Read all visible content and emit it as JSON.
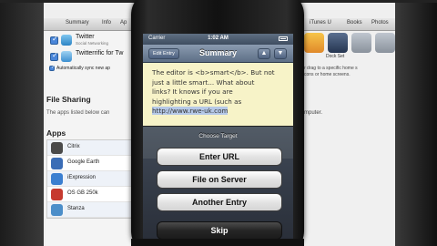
{
  "itunes": {
    "tabs": [
      "Summary",
      "Info",
      "Ap",
      "iTunes U",
      "Books",
      "Photos"
    ],
    "top_apps": [
      {
        "name": "Twitter",
        "sub": "Social Networking"
      },
      {
        "name": "Twitterrific for Tw",
        "sub": ""
      }
    ],
    "sync_label": "Automatically sync new ap",
    "file_sharing_title": "File Sharing",
    "file_sharing_desc": "The apps listed below can",
    "apps_title": "Apps",
    "apps": [
      {
        "name": "Citrix",
        "color": "#4a4a4a"
      },
      {
        "name": "Google Earth",
        "color": "#3a6db6"
      },
      {
        "name": "iExpression",
        "color": "#3b7fd0"
      },
      {
        "name": "OS GB 250k",
        "color": "#c63a2f"
      },
      {
        "name": "Stanza",
        "color": "#4c8ec9"
      }
    ],
    "right_text_1": "r drag to a specific home s",
    "right_text_2": "cons or home screens.",
    "right_text_3": "mputer.",
    "dock_set_label": "Dock Set"
  },
  "phone": {
    "carrier": "Carrier",
    "time": "1:02 AM",
    "nav_back": "Edit Entry",
    "nav_title": "Summary",
    "nav_up": "▲",
    "nav_down": "▼",
    "note_lines": [
      "The editor is <b>smart</b>. But not",
      "just a little smart... What about",
      "links? It knows if you are",
      "highlighting a URL (such as"
    ],
    "note_url": "http://www.rwe-uk.com"
  },
  "action_sheet": {
    "title": "Choose Target",
    "buttons": [
      "Enter URL",
      "File on Server",
      "Another Entry"
    ],
    "skip": "Skip"
  }
}
